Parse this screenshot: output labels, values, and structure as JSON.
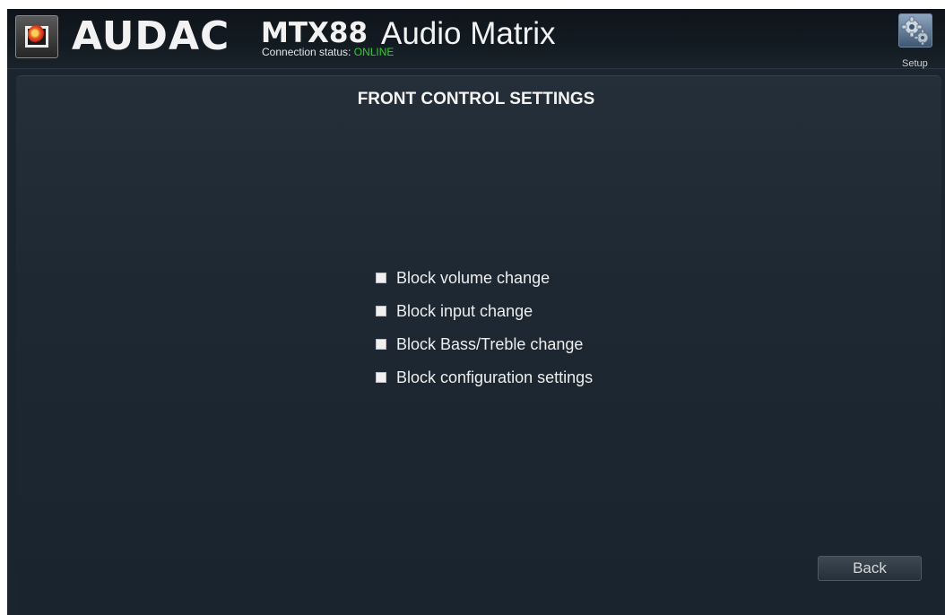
{
  "header": {
    "brand": "AUDAC",
    "model": "MTX88",
    "product": "Audio Matrix",
    "connection_label": "Connection status:",
    "connection_status": "ONLINE",
    "setup_label": "Setup",
    "logo_icon": "audac-logo-icon",
    "setup_icon": "gears-icon"
  },
  "page": {
    "title": "FRONT CONTROL SETTINGS"
  },
  "options": [
    {
      "label": "Block volume change",
      "checked": false
    },
    {
      "label": "Block input change",
      "checked": false
    },
    {
      "label": "Block Bass/Treble change",
      "checked": false
    },
    {
      "label": "Block configuration settings",
      "checked": false
    }
  ],
  "footer": {
    "back_label": "Back"
  },
  "colors": {
    "status_online": "#2bd12b",
    "background": "#1b2530",
    "text": "#f2f2f2"
  }
}
